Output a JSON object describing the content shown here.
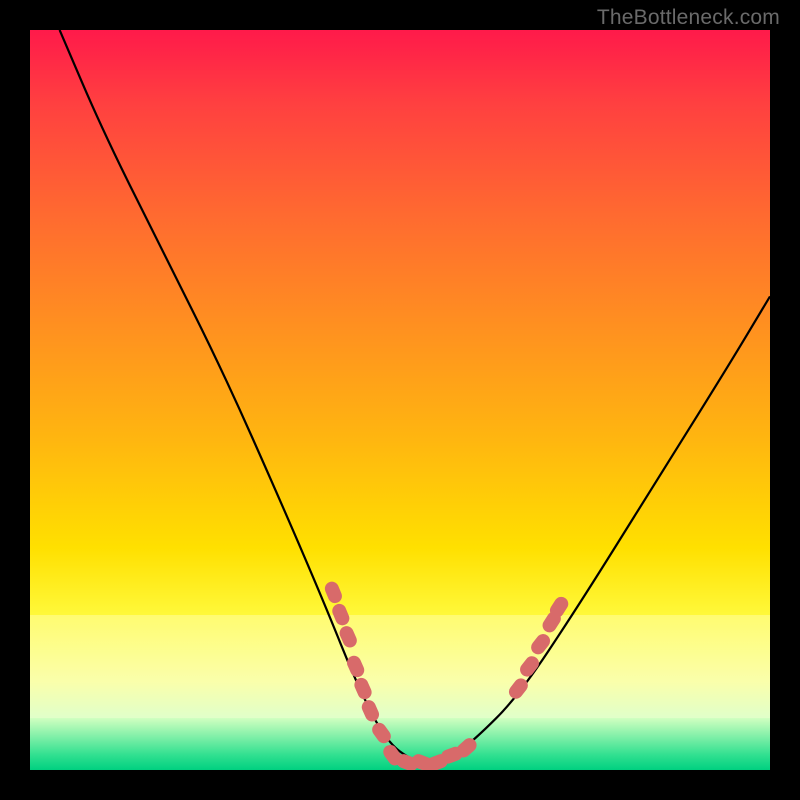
{
  "watermark": "TheBottleneck.com",
  "chart_data": {
    "type": "line",
    "title": "",
    "xlabel": "",
    "ylabel": "",
    "xlim": [
      0,
      100
    ],
    "ylim": [
      0,
      100
    ],
    "background_gradient": {
      "top": "#ff1a4a",
      "bottom": "#00d080",
      "description": "vertical red-orange-yellow-green gradient"
    },
    "series": [
      {
        "name": "curve",
        "x": [
          4,
          10,
          18,
          26,
          34,
          40,
          44,
          48,
          52,
          56,
          60,
          66,
          74,
          84,
          94,
          100
        ],
        "y": [
          100,
          86,
          70,
          54,
          36,
          22,
          12,
          4,
          1,
          1,
          4,
          10,
          22,
          38,
          54,
          64
        ],
        "stroke": "#000000"
      }
    ],
    "markers": [
      {
        "name": "left-cluster",
        "color": "#d86a6a",
        "points": [
          {
            "x": 41,
            "y": 24
          },
          {
            "x": 42,
            "y": 21
          },
          {
            "x": 43,
            "y": 18
          },
          {
            "x": 44,
            "y": 14
          },
          {
            "x": 45,
            "y": 11
          },
          {
            "x": 46,
            "y": 8
          },
          {
            "x": 47.5,
            "y": 5
          }
        ]
      },
      {
        "name": "bottom-cluster",
        "color": "#d86a6a",
        "points": [
          {
            "x": 49,
            "y": 2
          },
          {
            "x": 51,
            "y": 1
          },
          {
            "x": 53,
            "y": 1
          },
          {
            "x": 55,
            "y": 1
          },
          {
            "x": 57,
            "y": 2
          },
          {
            "x": 59,
            "y": 3
          }
        ]
      },
      {
        "name": "right-cluster",
        "color": "#d86a6a",
        "points": [
          {
            "x": 66,
            "y": 11
          },
          {
            "x": 67.5,
            "y": 14
          },
          {
            "x": 69,
            "y": 17
          },
          {
            "x": 70.5,
            "y": 20
          },
          {
            "x": 71.5,
            "y": 22
          }
        ]
      }
    ]
  }
}
